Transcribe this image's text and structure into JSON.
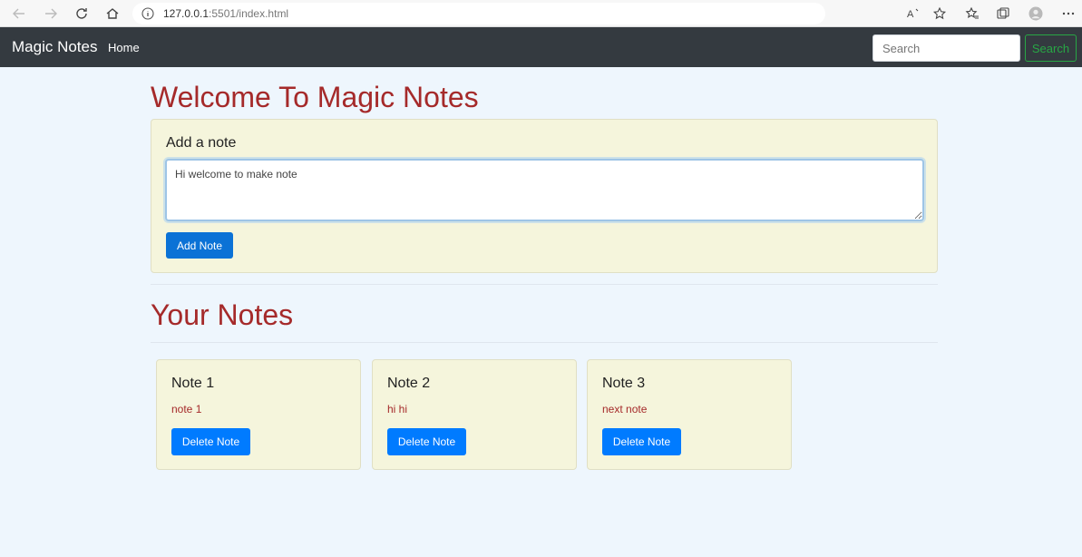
{
  "browser": {
    "url_host": "127.0.0.1",
    "url_rest": ":5501/index.html"
  },
  "navbar": {
    "brand": "Magic Notes",
    "home": "Home",
    "search_placeholder": "Search",
    "search_button": "Search"
  },
  "main": {
    "welcome_heading": "Welcome To Magic Notes",
    "add_card": {
      "title": "Add a note",
      "textarea_value": "Hi welcome to make note",
      "button": "Add Note"
    },
    "notes_heading": "Your Notes",
    "notes": [
      {
        "title": "Note 1",
        "text": "note 1",
        "delete": "Delete Note"
      },
      {
        "title": "Note 2",
        "text": "hi hi",
        "delete": "Delete Note"
      },
      {
        "title": "Note 3",
        "text": "next note",
        "delete": "Delete Note"
      }
    ]
  },
  "colors": {
    "accent_heading": "#a52a2a",
    "card_bg": "#f5f5dc",
    "primary": "#007bff",
    "search_green": "#28a745",
    "navbar_bg": "#343a40"
  }
}
